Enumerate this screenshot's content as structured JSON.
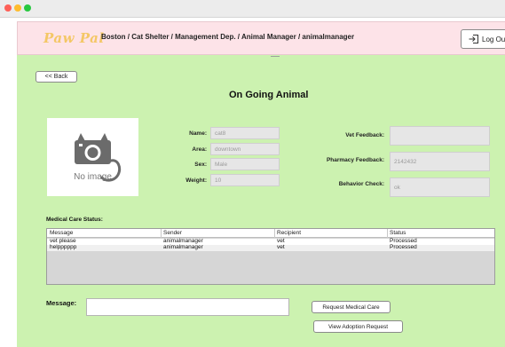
{
  "header": {
    "logo": "Paw Pal",
    "breadcrumb": "Boston / Cat Shelter / Management Dep. / Animal Manager / animalmanager",
    "logout_label": "Log Out"
  },
  "back_label": "<< Back",
  "page_title": "On Going Animal",
  "photo": {
    "placeholder_text": "No image",
    "icon": "no-image-camera-cat-icon"
  },
  "animal": {
    "name_label": "Name:",
    "name_value": "cat8",
    "area_label": "Area:",
    "area_value": "downtown",
    "sex_label": "Sex:",
    "sex_value": "Male",
    "weight_label": "Weight:",
    "weight_value": "10"
  },
  "feedback": {
    "vet_label": "Vet Feedback:",
    "vet_value": "",
    "pharmacy_label": "Pharmacy Feedback:",
    "pharmacy_value": "2142432",
    "behavior_label": "Behavior Check:",
    "behavior_value": "ok"
  },
  "medical_care": {
    "section_label": "Medical Care Status:",
    "columns": [
      "Message",
      "Sender",
      "Recipient",
      "Status"
    ],
    "rows": [
      [
        "vet please",
        "animalmanager",
        "vet",
        "Processed"
      ],
      [
        "helpppppp",
        "animalmanager",
        "vet",
        "Processed"
      ]
    ]
  },
  "message": {
    "label": "Message:",
    "value": ""
  },
  "actions": {
    "request_medical_care": "Request Medical Care",
    "view_adoption_request": "View Adoption Request"
  },
  "colors": {
    "panel_bg": "#ccf2b0",
    "header_bg": "#fde3e8",
    "logo": "#f4c766",
    "close_dot": "#fe5f57",
    "minimize_dot": "#febc2e",
    "maximize_dot": "#28c840"
  }
}
